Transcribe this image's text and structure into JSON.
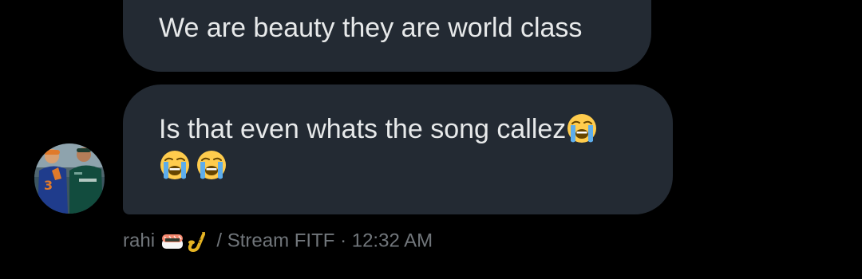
{
  "previous_message": {
    "text": "We are beauty they are world class"
  },
  "current_message": {
    "text_line1": "Is that even whats the song callez",
    "emoji_trailing": "😭",
    "emoji_line2": [
      "😭",
      "😭"
    ]
  },
  "sender": {
    "avatar_icon": "profile-photo-racing-drivers",
    "name_prefix": "rahi",
    "name_emojis": [
      "🍣",
      "🎷"
    ],
    "name_suffix": "/ Stream FITF",
    "separator": "·",
    "timestamp": "12:32 AM"
  },
  "colors": {
    "background": "#000000",
    "bubble": "#232a33",
    "message_text": "#e7e9ea",
    "meta_text": "#71767b"
  }
}
